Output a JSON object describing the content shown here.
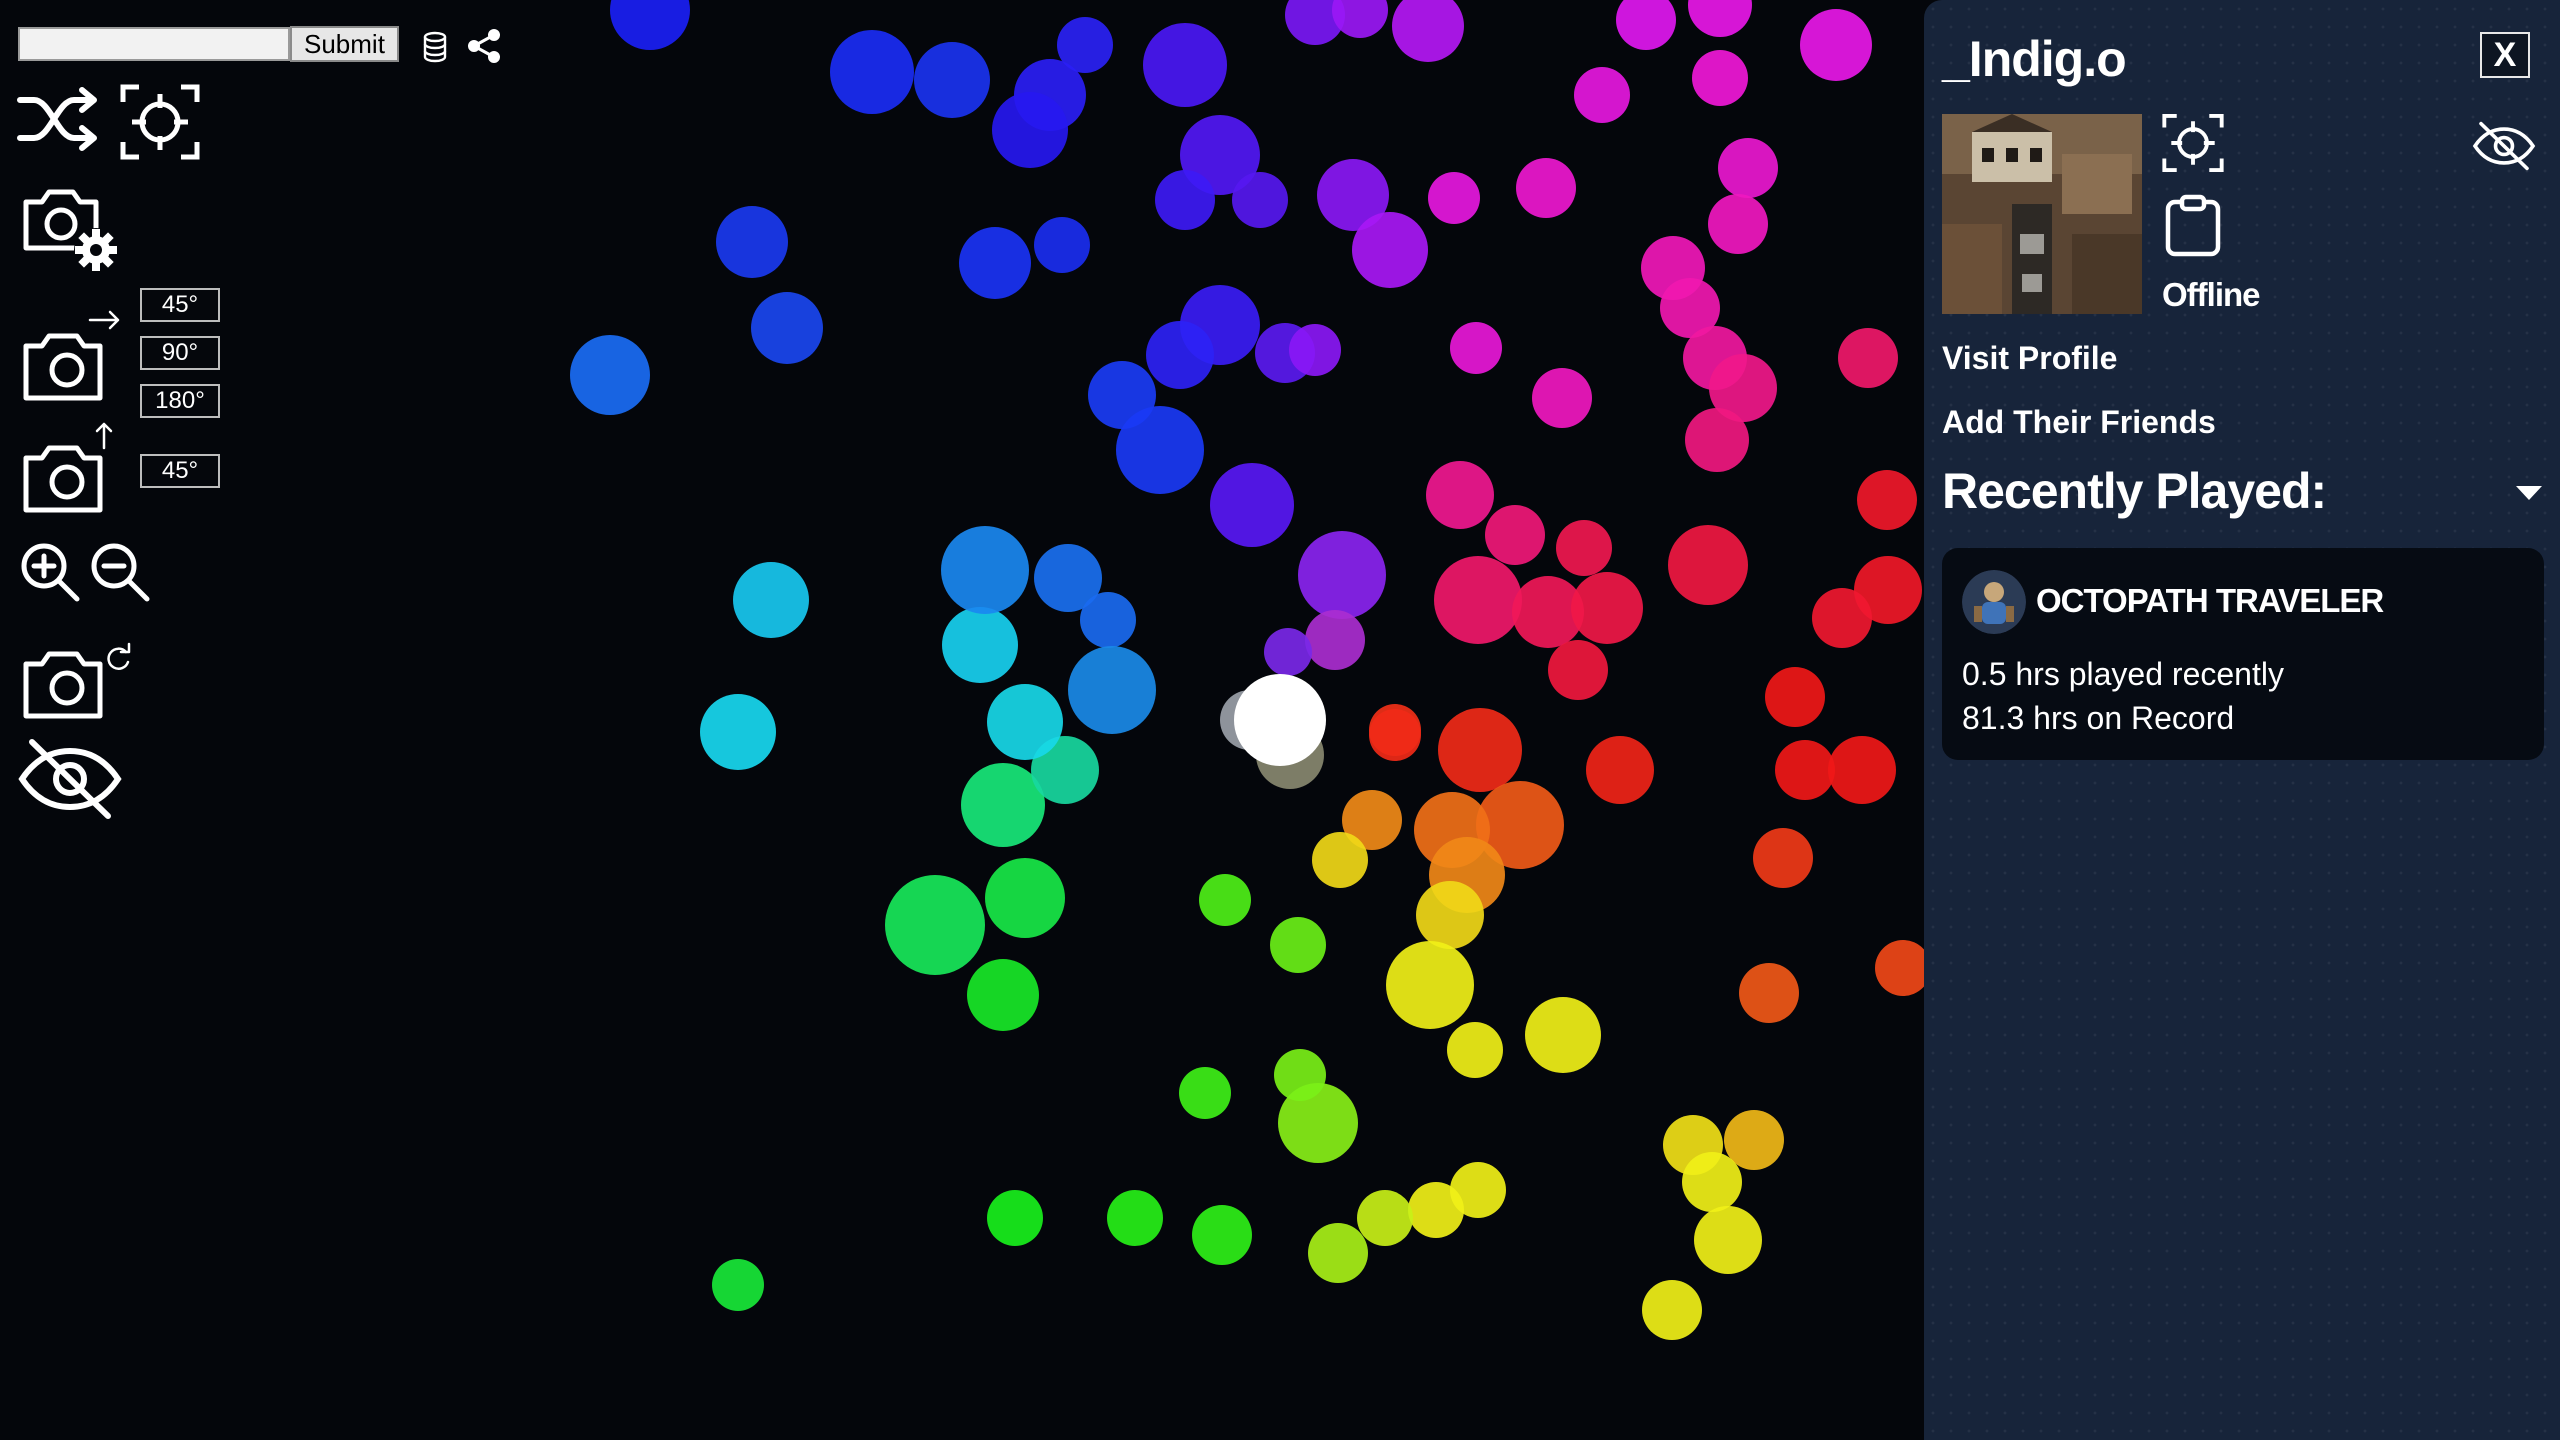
{
  "toolbar": {
    "search": {
      "value": "",
      "placeholder": ""
    },
    "submit_label": "Submit",
    "rotate_horizontal": [
      "45°",
      "90°",
      "180°"
    ],
    "rotate_vertical": [
      "45°"
    ]
  },
  "profile": {
    "username": "_Indig.o",
    "close_label": "X",
    "status": "Offline",
    "visit_profile_label": "Visit Profile",
    "add_friends_label": "Add Their Friends",
    "recently_played_title": "Recently Played:",
    "games": [
      {
        "title": "OCTOPATH TRAVELER",
        "recent": "0.5 hrs played recently",
        "record": "81.3 hrs on Record"
      }
    ]
  },
  "colors": {
    "background": "#04060b",
    "panel": "#17243a",
    "card": "#060b13",
    "center_node": "#ffffff"
  },
  "icons": [
    "database-icon",
    "share-icon",
    "shuffle-icon",
    "target-icon",
    "camera-settings-icon",
    "camera-rotate-horizontal-icon",
    "camera-rotate-vertical-icon",
    "zoom-in-icon",
    "zoom-out-icon",
    "camera-refresh-icon",
    "eye-off-icon",
    "clipboard-icon",
    "chevron-down-icon"
  ]
}
